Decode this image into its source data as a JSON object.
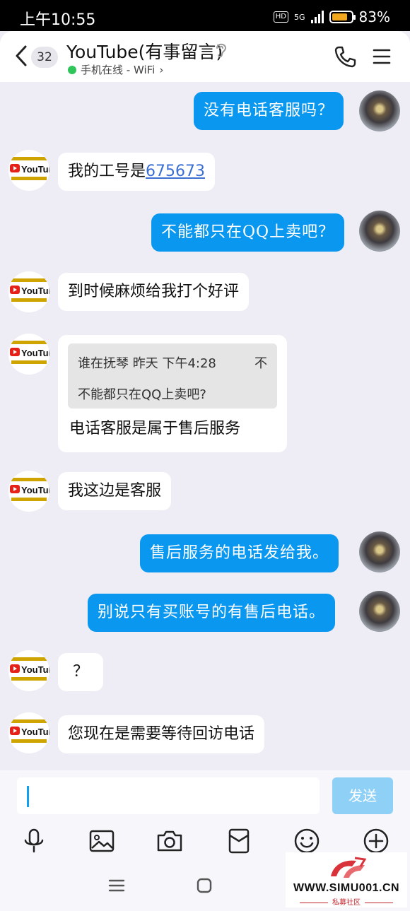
{
  "status_bar": {
    "time": "上午10:55",
    "hd": "HD",
    "network": "5G",
    "battery": "83%",
    "battery_level": 0.83
  },
  "header": {
    "unread_count": "32",
    "title": "YouTube(有事留言)",
    "presence": "手机在线 - WiFi"
  },
  "messages": [
    {
      "side": "right",
      "text": "没有电话客服吗？"
    },
    {
      "side": "left",
      "text": "我的工号是",
      "link": "675673"
    },
    {
      "side": "right",
      "text": "不能都只在QQ上卖吧？"
    },
    {
      "side": "left",
      "text": "到时候麻烦给我打个好评"
    },
    {
      "side": "left",
      "quote_author": "谁在抚琴",
      "quote_time": "昨天 下午4:28",
      "quote_text": "不能都只在QQ上卖吧?",
      "text": "电话客服是属于售后服务"
    },
    {
      "side": "left",
      "text": "我这边是客服"
    },
    {
      "side": "right",
      "text": "售后服务的电话发给我。"
    },
    {
      "side": "right",
      "text": "别说只有买账号的有售后电话。"
    },
    {
      "side": "left",
      "text": "？"
    },
    {
      "side": "left",
      "text": "您现在是需要等待回访电话"
    }
  ],
  "input": {
    "value": "",
    "send_label": "发送"
  },
  "toolbar": [
    "microphone-icon",
    "image-icon",
    "camera-icon",
    "red-packet-icon",
    "emoji-icon",
    "plus-icon"
  ],
  "avatar_text": {
    "brand": "YouTube"
  },
  "watermark": {
    "site": "WWW.SIMU001.CN",
    "sub": "私募社区"
  },
  "colors": {
    "accent": "#0a97ef",
    "online": "#2fc55b",
    "background": "#eeedf5"
  }
}
